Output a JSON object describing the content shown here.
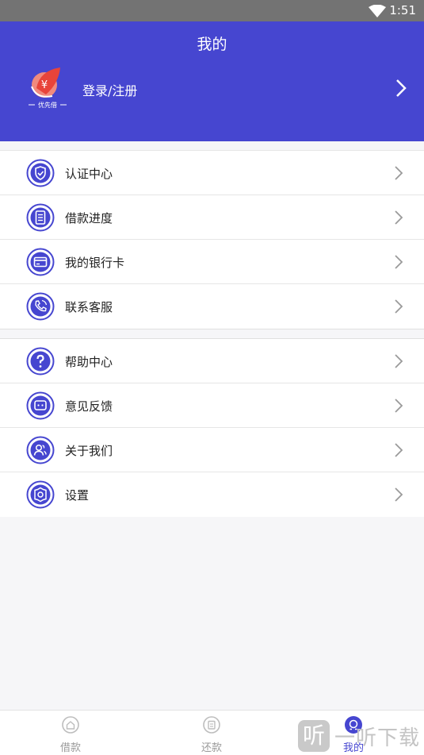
{
  "status_bar": {
    "time": "1:51"
  },
  "header": {
    "title": "我的",
    "login_label": "登录/注册",
    "logo_text": "优先借"
  },
  "menu_group_1": [
    {
      "label": "认证中心",
      "icon": "shield-check-icon"
    },
    {
      "label": "借款进度",
      "icon": "document-icon"
    },
    {
      "label": "我的银行卡",
      "icon": "bank-card-icon"
    },
    {
      "label": "联系客服",
      "icon": "phone-icon"
    }
  ],
  "menu_group_2": [
    {
      "label": "帮助中心",
      "icon": "question-icon"
    },
    {
      "label": "意见反馈",
      "icon": "feedback-icon"
    },
    {
      "label": "关于我们",
      "icon": "users-icon"
    },
    {
      "label": "设置",
      "icon": "gear-icon"
    }
  ],
  "tabbar": {
    "tabs": [
      {
        "label": "借款",
        "active": false
      },
      {
        "label": "还款",
        "active": false
      },
      {
        "label": "我的",
        "active": true
      }
    ]
  },
  "watermark": {
    "box": "听",
    "text": "一听下载"
  },
  "colors": {
    "brand": "#4646d0",
    "status_bar": "#737373",
    "background": "#f6f6f8"
  }
}
